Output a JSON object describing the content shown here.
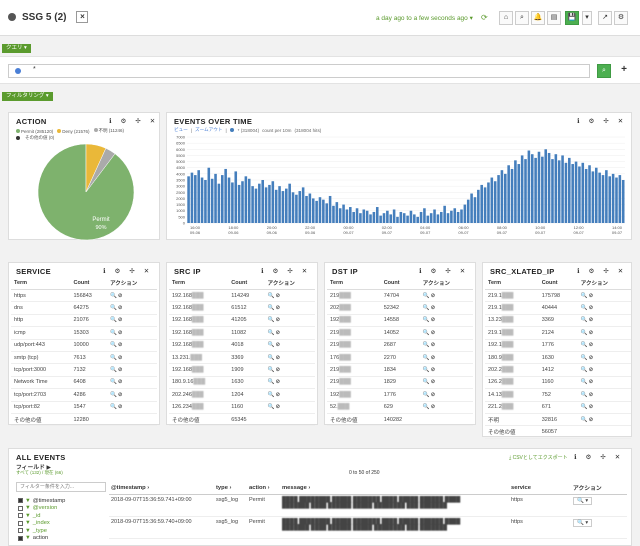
{
  "header": {
    "title": "SSG 5 (2)",
    "close": "×",
    "timerange": "a day ago to a few seconds ago",
    "caret": "▾",
    "buttons": [
      "⌂",
      "⌕",
      "🔔",
      "▤",
      "💾",
      "▾",
      "↗",
      "⚙"
    ]
  },
  "query_row_label": "クエリ ▾",
  "query": {
    "text": "*",
    "search": "⌕",
    "add": "+"
  },
  "filter_row_label": "フィルタリング ▾",
  "panel_icons": [
    "ℹ",
    "⚙",
    "✢",
    "✕"
  ],
  "action_panel": {
    "title": "ACTION",
    "legend": [
      {
        "label": "Permit (285120)",
        "color": "#7eb26d"
      },
      {
        "label": "Deny (21576)",
        "color": "#eab839"
      },
      {
        "label": "不明 (11246)",
        "color": "#aaaaaa"
      }
    ],
    "other": "その他の値 (0)",
    "pie_label": "Permit",
    "pie_pct": "90%",
    "chart_data": {
      "type": "pie",
      "categories": [
        "Permit",
        "Deny",
        "不明"
      ],
      "values": [
        285120,
        21576,
        11246
      ],
      "colors": [
        "#7eb26d",
        "#eab839",
        "#aaaaaa"
      ]
    }
  },
  "events_panel": {
    "title": "EVENTS OVER TIME",
    "subline_view": "ビュー",
    "subline_zoom": "ズームアウト",
    "subline_series": "* (318004)",
    "subline_count": "count per 10m",
    "subline_total": "(318004 hits)",
    "chart_data": {
      "type": "bar",
      "y_ticks": [
        "0",
        "500",
        "1000",
        "1500",
        "2000",
        "2500",
        "3000",
        "3500",
        "4000",
        "4500",
        "5000",
        "5500",
        "6000",
        "6500",
        "7000"
      ],
      "ylim": [
        0,
        7000
      ],
      "x_ticks": [
        [
          "16:00",
          "09-06"
        ],
        [
          "18:00",
          "09-06"
        ],
        [
          "20:00",
          "09-06"
        ],
        [
          "22:00",
          "09-06"
        ],
        [
          "00:00",
          "09-07"
        ],
        [
          "02:00",
          "09-07"
        ],
        [
          "04:00",
          "09-07"
        ],
        [
          "06:00",
          "09-07"
        ],
        [
          "08:00",
          "09-07"
        ],
        [
          "10:00",
          "09-07"
        ],
        [
          "12:00",
          "09-07"
        ],
        [
          "14:00",
          "09-07"
        ]
      ],
      "color": "#447ebc",
      "values": [
        3800,
        4100,
        3900,
        4300,
        3700,
        3500,
        4500,
        3600,
        4000,
        3200,
        3900,
        4400,
        3700,
        3300,
        4200,
        3100,
        3400,
        3800,
        3600,
        3000,
        2800,
        3200,
        3500,
        2900,
        3100,
        3400,
        2700,
        3000,
        2600,
        2800,
        3200,
        2500,
        2300,
        2600,
        2900,
        2200,
        2400,
        2000,
        1800,
        2100,
        1900,
        1600,
        2200,
        1400,
        1700,
        1200,
        1500,
        1100,
        1300,
        900,
        1200,
        800,
        1100,
        1000,
        700,
        900,
        1300,
        600,
        800,
        1000,
        700,
        1100,
        500,
        900,
        800,
        600,
        1000,
        700,
        500,
        900,
        1200,
        600,
        800,
        1100,
        700,
        900,
        1400,
        800,
        1000,
        1200,
        900,
        1100,
        1500,
        1900,
        2400,
        2100,
        2700,
        3100,
        2900,
        3300,
        3700,
        3400,
        3900,
        4300,
        4000,
        4700,
        4400,
        5100,
        4800,
        5500,
        5200,
        5900,
        5600,
        5300,
        5800,
        5400,
        6000,
        5700,
        5200,
        5600,
        5100,
        5500,
        4900,
        5300,
        4800,
        5000,
        4600,
        4900,
        4400,
        4700,
        4200,
        4500,
        4100,
        3900,
        4300,
        3800,
        4000,
        3700,
        3900,
        3500
      ]
    }
  },
  "service_panel": {
    "title": "SERVICE",
    "headers": [
      "Term",
      "Count",
      "アクション"
    ],
    "rows": [
      [
        "https",
        "156843"
      ],
      [
        "dns",
        "64275"
      ],
      [
        "http",
        "21076"
      ],
      [
        "icmp",
        "15303"
      ],
      [
        "udp/port:443",
        "10000"
      ],
      [
        "smtp (tcp)",
        "7613"
      ],
      [
        "tcp/port:3000",
        "7132"
      ],
      [
        "Network Time",
        "6408"
      ],
      [
        "tcp/port:2703",
        "4286"
      ],
      [
        "tcp/port:82",
        "1547"
      ]
    ],
    "other": [
      "その他の値",
      "12280"
    ]
  },
  "srcip_panel": {
    "title": "SRC IP",
    "headers": [
      "Term",
      "Count",
      "アクション"
    ],
    "rows": [
      [
        "192.168",
        "114249"
      ],
      [
        "192.168",
        "61512"
      ],
      [
        "192.168",
        "41205"
      ],
      [
        "192.168",
        "11082"
      ],
      [
        "192.168",
        "4018"
      ],
      [
        "13.231.",
        "3369"
      ],
      [
        "192.168",
        "1909"
      ],
      [
        "180.9.16",
        "1630"
      ],
      [
        "202.246",
        "1204"
      ],
      [
        "126.234",
        "1160"
      ]
    ],
    "other": [
      "その他の値",
      "65345"
    ]
  },
  "dstip_panel": {
    "title": "DST IP",
    "headers": [
      "Term",
      "Count",
      "アクション"
    ],
    "rows": [
      [
        "219",
        "74704"
      ],
      [
        "202",
        "52342"
      ],
      [
        "192",
        "14558"
      ],
      [
        "219",
        "14052"
      ],
      [
        "219",
        "2687"
      ],
      [
        "176",
        "2270"
      ],
      [
        "219",
        "1834"
      ],
      [
        "219",
        "1829"
      ],
      [
        "192",
        "1776"
      ],
      [
        "52.",
        "629"
      ]
    ],
    "other": [
      "その他の値",
      "140282"
    ]
  },
  "srcx_panel": {
    "title": "SRC_XLATED_IP",
    "headers": [
      "Term",
      "Count",
      "アクション"
    ],
    "rows": [
      [
        "219.1",
        "175798"
      ],
      [
        "219.1",
        "40444"
      ],
      [
        "13.23",
        "3369"
      ],
      [
        "219.1",
        "2124"
      ],
      [
        "192.1",
        "1776"
      ],
      [
        "180.9",
        "1630"
      ],
      [
        "202.2",
        "1412"
      ],
      [
        "126.2",
        "1160"
      ],
      [
        "14.13",
        "752"
      ],
      [
        "221.2",
        "671"
      ],
      [
        "不明",
        "32816"
      ]
    ],
    "other": [
      "その他の値",
      "56057"
    ]
  },
  "actions_glyph": "🔍⊘",
  "all_events": {
    "title": "ALL EVENTS",
    "fields_label": "フィールド ▶",
    "fields_sub": "すべて (132) / 現在 (66)",
    "export": "⤓ CSVとしてエクスポート",
    "pager": "0 to 50 of 250",
    "filter_placeholder": "フィルター条件を入力...",
    "field_list": [
      "@timestamp",
      "@version",
      "_id",
      "_index",
      "_type",
      "action"
    ],
    "field_checked": [
      true,
      false,
      false,
      false,
      false,
      true
    ],
    "columns": [
      "@timestamp ›",
      "type ›",
      "action ›",
      "message ›",
      "service",
      "アクション"
    ],
    "rows": [
      [
        "2018-09-07T15:36:59.741+09:00",
        "ssg5_log",
        "Permit",
        "https"
      ],
      [
        "2018-09-07T15:36:59.740+09:00",
        "ssg5_log",
        "Permit",
        "https"
      ]
    ]
  }
}
